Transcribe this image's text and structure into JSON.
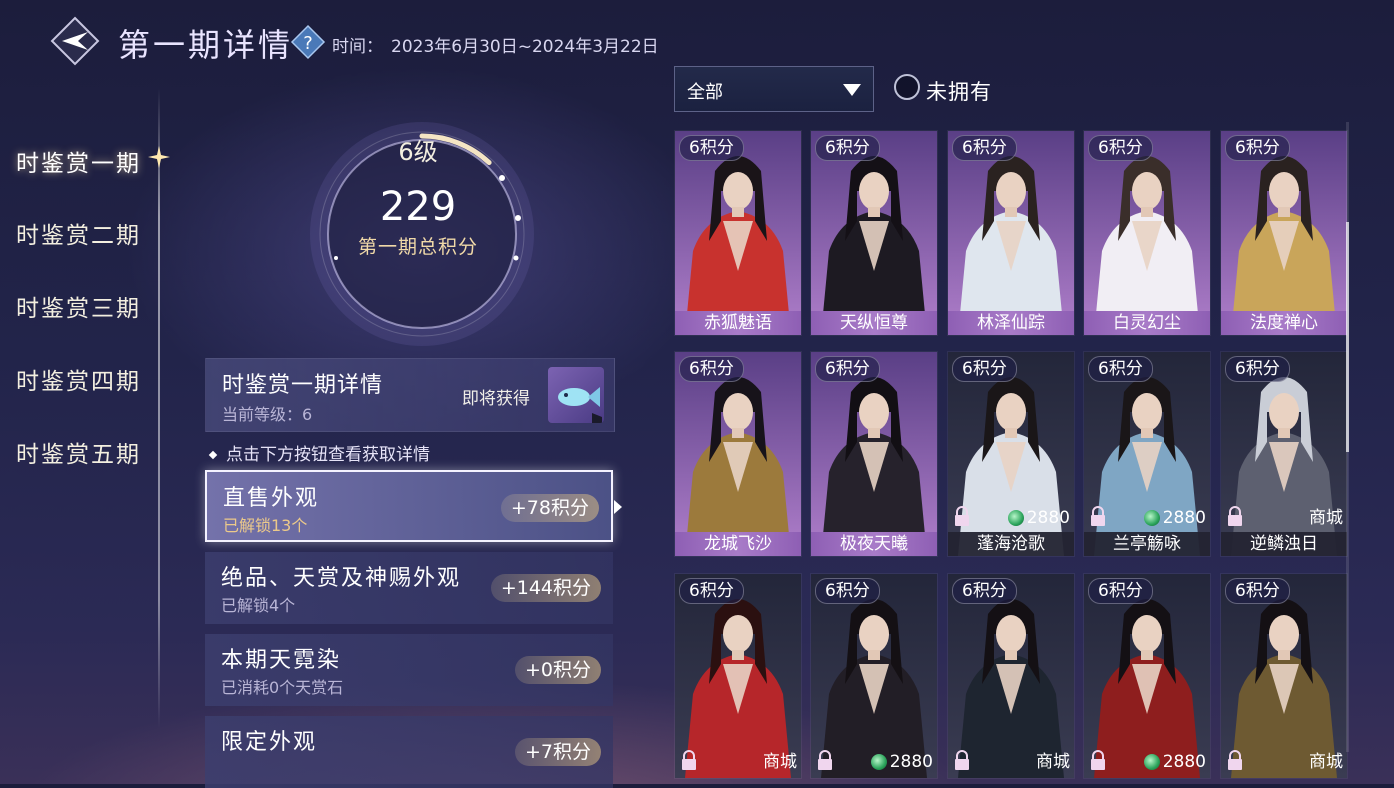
{
  "header": {
    "title": "第一期详情",
    "period_label": "时间：",
    "period_value": "2023年6月30日~2024年3月22日"
  },
  "sidebar": {
    "items": [
      {
        "label": "时鉴赏一期",
        "active": true
      },
      {
        "label": "时鉴赏二期",
        "active": false
      },
      {
        "label": "时鉴赏三期",
        "active": false
      },
      {
        "label": "时鉴赏四期",
        "active": false
      },
      {
        "label": "时鉴赏五期",
        "active": false
      }
    ]
  },
  "level": {
    "level_text": "6级",
    "total_points": "229",
    "total_label": "第一期总积分",
    "progress": 0.12
  },
  "detail": {
    "title": "时鉴赏一期详情",
    "current_level": "当前等级：6",
    "upcoming": "即将获得"
  },
  "hint": "点击下方按钮查看获取详情",
  "categories": [
    {
      "title": "直售外观",
      "subtitle": "已解锁13个",
      "points": "+78积分",
      "selected": true
    },
    {
      "title": "绝品、天赏及神赐外观",
      "subtitle": "已解锁4个",
      "points": "+144积分",
      "selected": false
    },
    {
      "title": "本期天霓染",
      "subtitle": "已消耗0个天赏石",
      "points": "+0积分",
      "selected": false
    },
    {
      "title": "限定外观",
      "subtitle": "",
      "points": "+7积分",
      "selected": false
    }
  ],
  "filter": {
    "selected": "全部",
    "unowned_label": "未拥有"
  },
  "grid": {
    "cards": [
      {
        "points": "6积分",
        "name": "赤狐魅语",
        "owned": true,
        "price": "",
        "style": "purple",
        "outfit": "#c8322e",
        "hair": "#1a1418"
      },
      {
        "points": "6积分",
        "name": "天纵恒尊",
        "owned": true,
        "price": "",
        "style": "purple",
        "outfit": "#1d1a22",
        "hair": "#141016"
      },
      {
        "points": "6积分",
        "name": "林泽仙踪",
        "owned": true,
        "price": "",
        "style": "purple",
        "outfit": "#dfe6ee",
        "hair": "#2a2220"
      },
      {
        "points": "6积分",
        "name": "白灵幻尘",
        "owned": true,
        "price": "",
        "style": "purple",
        "outfit": "#f1eef4",
        "hair": "#3a2e2a"
      },
      {
        "points": "6积分",
        "name": "法度禅心",
        "owned": true,
        "price": "",
        "style": "purple",
        "outfit": "#c9a55a",
        "hair": "#2a2220"
      },
      {
        "points": "6积分",
        "name": "龙城飞沙",
        "owned": true,
        "price": "",
        "style": "purple",
        "outfit": "#9c7a3c",
        "hair": "#17131a"
      },
      {
        "points": "6积分",
        "name": "极夜天曦",
        "owned": true,
        "price": "",
        "style": "purple",
        "outfit": "#26222c",
        "hair": "#120f14"
      },
      {
        "points": "6积分",
        "name": "蓬海沧歌",
        "owned": false,
        "price": "2880",
        "style": "dark",
        "outfit": "#d9dfe8",
        "hair": "#1a1618"
      },
      {
        "points": "6积分",
        "name": "兰亭觞咏",
        "owned": false,
        "price": "2880",
        "style": "dark",
        "outfit": "#7fa6c4",
        "hair": "#1a1618"
      },
      {
        "points": "6积分",
        "name": "逆鳞浊日",
        "owned": false,
        "price": "商城",
        "style": "dark",
        "outfit": "#5d6070",
        "hair": "#c9cdd6"
      },
      {
        "points": "6积分",
        "name": "",
        "owned": false,
        "price": "商城",
        "style": "dark",
        "outfit": "#b6262a",
        "hair": "#2b1010"
      },
      {
        "points": "6积分",
        "name": "",
        "owned": false,
        "price": "2880",
        "style": "dark",
        "outfit": "#221e26",
        "hair": "#141014"
      },
      {
        "points": "6积分",
        "name": "",
        "owned": false,
        "price": "商城",
        "style": "dark",
        "outfit": "#1e2530",
        "hair": "#141014"
      },
      {
        "points": "6积分",
        "name": "",
        "owned": false,
        "price": "2880",
        "style": "dark",
        "outfit": "#8e1e1e",
        "hair": "#141014"
      },
      {
        "points": "6积分",
        "name": "",
        "owned": false,
        "price": "商城",
        "style": "dark",
        "outfit": "#6e5a32",
        "hair": "#141014"
      }
    ]
  }
}
